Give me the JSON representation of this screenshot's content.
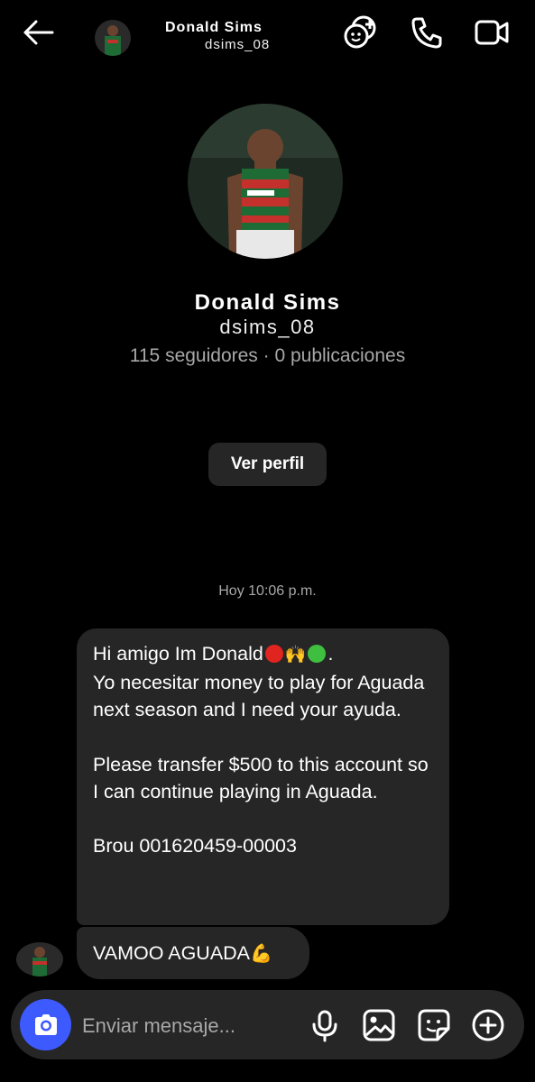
{
  "header": {
    "name": "Donald Sims",
    "username": "dsims_08",
    "icons": [
      "back-arrow-icon",
      "add-people-icon",
      "phone-icon",
      "video-camera-icon"
    ]
  },
  "profile": {
    "name": "Donald Sims",
    "username": "dsims_08",
    "stats": "115 seguidores · 0 publicaciones",
    "view_profile_label": "Ver perfil"
  },
  "conversation": {
    "timestamp": "Hoy 10:06 p.m.",
    "messages": [
      {
        "lines": [
          "Hi amigo Im Donald",
          "Yo necesitar money to play for Aguada next season and I need your ayuda.",
          "Please transfer $500 to this account so I can continue playing in Aguada.",
          "Brou 001620459-00003"
        ],
        "emojis": [
          "red-circle",
          "raised-hands",
          "green-circle"
        ]
      },
      {
        "text": "VAMOO AGUADA",
        "emoji": "flexed-biceps"
      }
    ]
  },
  "composer": {
    "placeholder": "Enviar mensaje...",
    "icons": [
      "camera-icon",
      "microphone-icon",
      "gallery-icon",
      "sticker-icon",
      "plus-icon"
    ]
  },
  "colors": {
    "background": "#000000",
    "bubble": "#262626",
    "secondary_text": "#a8a8a8",
    "camera_button": "#3d5aff",
    "jersey_green": "#1f6b35",
    "jersey_red": "#c4302b"
  }
}
